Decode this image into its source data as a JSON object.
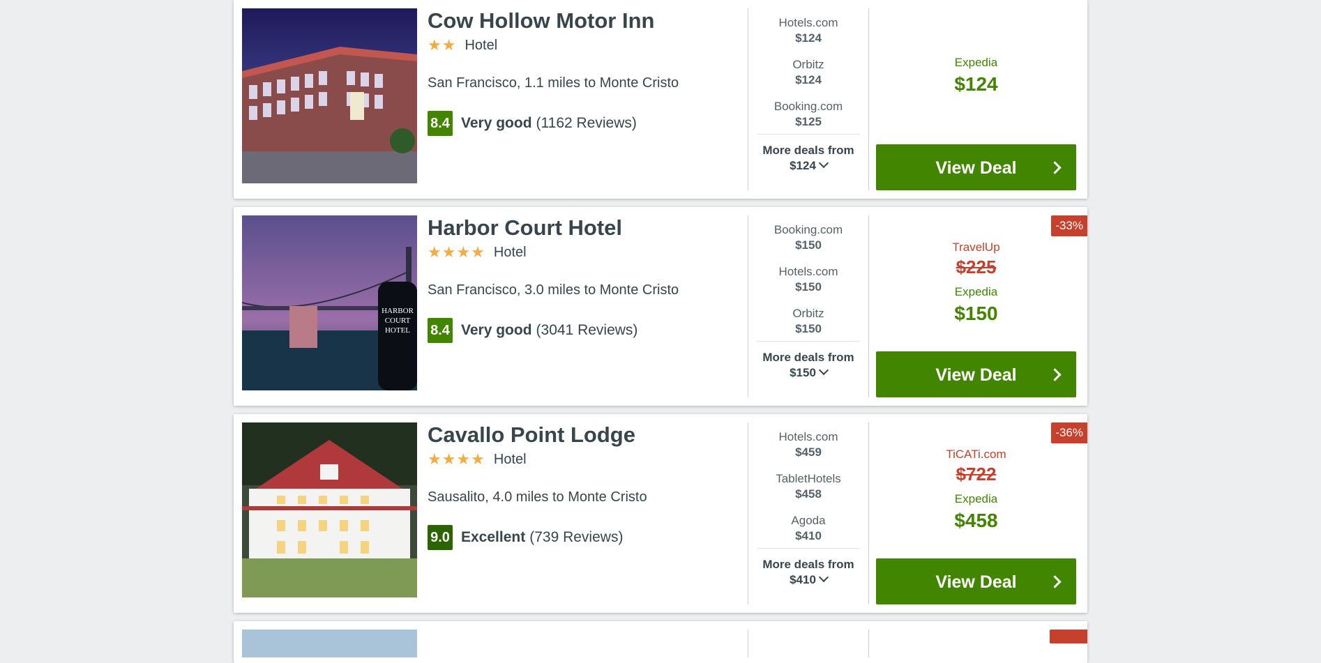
{
  "colors": {
    "accent_green": "#428500",
    "discount_red": "#c7402b",
    "star_orange": "#f6ab3f",
    "page_background": "#eceef0"
  },
  "view_deal_label": "View Deal",
  "more_deals_label": "More deals from",
  "hotels": [
    {
      "name": "Cow Hollow Motor Inn",
      "stars": "★★",
      "star_count": 2,
      "type": "Hotel",
      "location": "San Francisco, 1.1 miles to Monte Cristo",
      "rating": "8.4",
      "rating_text": "Very good",
      "reviews": "(1162 Reviews)",
      "deals": [
        {
          "provider": "Hotels.com",
          "price": "$124"
        },
        {
          "provider": "Orbitz",
          "price": "$124"
        },
        {
          "provider": "Booking.com",
          "price": "$125"
        }
      ],
      "more_deals_price": "$124",
      "best_provider": "Expedia",
      "best_price": "$124",
      "old_provider": "",
      "old_price": "",
      "discount": ""
    },
    {
      "name": "Harbor Court Hotel",
      "stars": "★★★★",
      "star_count": 4,
      "type": "Hotel",
      "location": "San Francisco, 3.0 miles to Monte Cristo",
      "rating": "8.4",
      "rating_text": "Very good",
      "reviews": "(3041 Reviews)",
      "deals": [
        {
          "provider": "Booking.com",
          "price": "$150"
        },
        {
          "provider": "Hotels.com",
          "price": "$150"
        },
        {
          "provider": "Orbitz",
          "price": "$150"
        }
      ],
      "more_deals_price": "$150",
      "best_provider": "Expedia",
      "best_price": "$150",
      "old_provider": "TravelUp",
      "old_price": "$225",
      "discount": "-33%"
    },
    {
      "name": "Cavallo Point Lodge",
      "stars": "★★★★",
      "star_count": 4,
      "type": "Hotel",
      "location": "Sausalito, 4.0 miles to Monte Cristo",
      "rating": "9.0",
      "rating_text": "Excellent",
      "reviews": "(739 Reviews)",
      "deals": [
        {
          "provider": "Hotels.com",
          "price": "$459"
        },
        {
          "provider": "TabletHotels",
          "price": "$458"
        },
        {
          "provider": "Agoda",
          "price": "$410"
        }
      ],
      "more_deals_price": "$410",
      "best_provider": "Expedia",
      "best_price": "$458",
      "old_provider": "TiCATi.com",
      "old_price": "$722",
      "discount": "-36%"
    }
  ]
}
